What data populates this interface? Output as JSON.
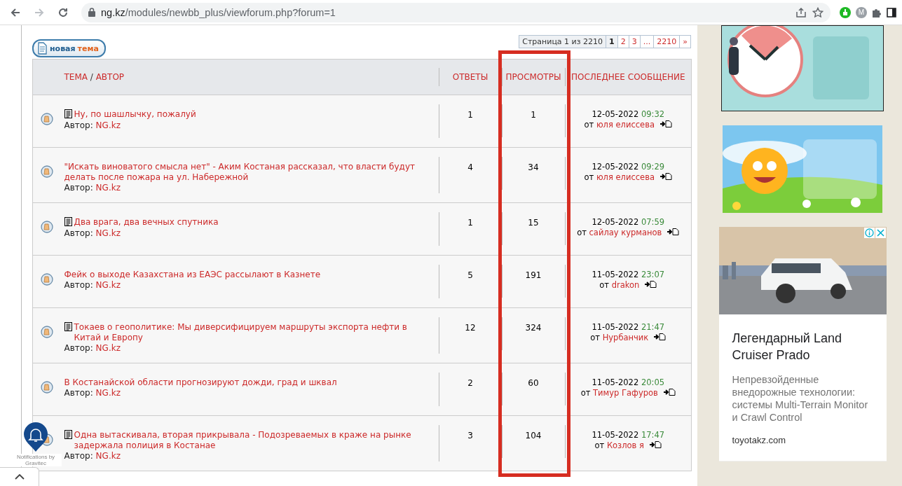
{
  "browser": {
    "url_host": "ng.kz",
    "url_path": "/modules/newbb_plus/viewforum.php?forum=1",
    "forward_disabled": true,
    "profile_initial": "M"
  },
  "forum": {
    "new_topic": {
      "word1": "новая",
      "word2": "тема"
    },
    "pagination": {
      "label": "Страница 1 из 2210",
      "pages": [
        {
          "label": "1",
          "selected": true
        },
        {
          "label": "2",
          "selected": false
        },
        {
          "label": "3",
          "selected": false
        },
        {
          "label": "...",
          "selected": false
        },
        {
          "label": "2210",
          "selected": false
        },
        {
          "label": "»",
          "selected": false
        }
      ]
    },
    "columns": [
      {
        "parts": [
          "ТЕМА",
          "/",
          "АВТОР"
        ],
        "highlighted": false
      },
      {
        "parts": [
          "ОТВЕТЫ"
        ],
        "highlighted": false
      },
      {
        "parts": [
          "ПРОСМОТРЫ"
        ],
        "highlighted": true
      },
      {
        "parts": [
          "ПОСЛЕДНЕЕ СООБЩЕНИЕ"
        ],
        "highlighted": false
      }
    ],
    "topics": [
      {
        "doc_icon": true,
        "title": "Ну, по шашлычку, пожалуй",
        "author_label": "Автор:",
        "author": "NG.kz",
        "replies": "1",
        "views": "1",
        "date": "12-05-2022",
        "time": "09:32",
        "by": "от",
        "user": "юля елиссева"
      },
      {
        "doc_icon": false,
        "title": "\"Искать виноватого смысла нет\" - Аким Костаная рассказал, что власти будут делать после пожара на ул. Набережной",
        "author_label": "Автор:",
        "author": "NG.kz",
        "replies": "4",
        "views": "34",
        "date": "12-05-2022",
        "time": "09:29",
        "by": "от",
        "user": "юля елиссева"
      },
      {
        "doc_icon": true,
        "title": "Два врага, два вечных спутника",
        "author_label": "Автор:",
        "author": "NG.kz",
        "replies": "1",
        "views": "15",
        "date": "12-05-2022",
        "time": "07:59",
        "by": "от",
        "user": "сайлау курманов"
      },
      {
        "doc_icon": false,
        "title": "Фейк о выходе Казахстана из ЕАЭС рассылают в Казнете",
        "author_label": "Автор:",
        "author": "NG.kz",
        "replies": "5",
        "views": "191",
        "date": "11-05-2022",
        "time": "23:07",
        "by": "от",
        "user": "drakon"
      },
      {
        "doc_icon": true,
        "title": "Токаев о геополитике: Мы диверсифицируем маршруты экспорта нефти в Китай и Европу",
        "author_label": "Автор:",
        "author": "NG.kz",
        "replies": "12",
        "views": "324",
        "date": "11-05-2022",
        "time": "21:47",
        "by": "от",
        "user": "Нурбанчик"
      },
      {
        "doc_icon": false,
        "title": "В Костанайской области прогнозируют дожди, град и шквал",
        "author_label": "Автор:",
        "author": "NG.kz",
        "replies": "2",
        "views": "60",
        "date": "11-05-2022",
        "time": "20:05",
        "by": "от",
        "user": "Тимур Гафуров"
      },
      {
        "doc_icon": true,
        "title": "Одна вытаскивала, вторая прикрывала - Подозреваемых в краже на рынке задержала полиция в Костанае",
        "author_label": "Автор:",
        "author": "NG.kz",
        "replies": "3",
        "views": "104",
        "date": "11-05-2022",
        "time": "17:47",
        "by": "от",
        "user": "Козлов я"
      }
    ]
  },
  "ads": [
    {
      "kind": "banner"
    },
    {
      "kind": "banner"
    },
    {
      "kind": "card",
      "title": "Легендарный Land Cruiser Prado",
      "description": "Непревзойденные внедорожные технологии: системы Multi-Terrain Monitor и Crawl Control",
      "domain": "toyotakz.com"
    }
  ],
  "notifications": {
    "caption": "Notifications by Gravitec"
  }
}
